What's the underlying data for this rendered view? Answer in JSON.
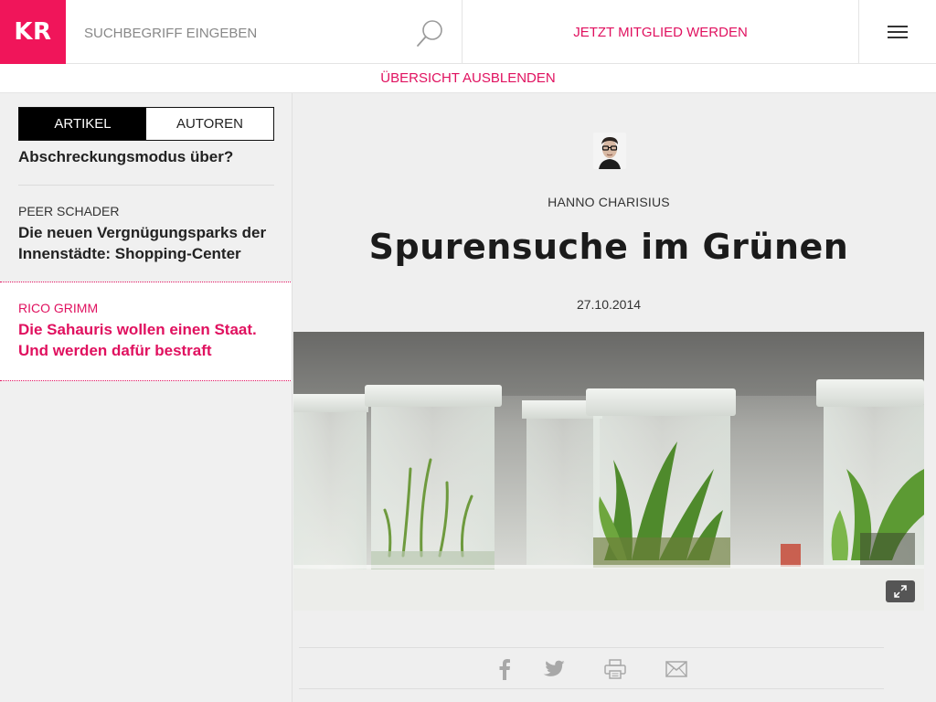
{
  "header": {
    "logo_text": "KR",
    "search_placeholder": "SUCHBEGRIFF EINGEBEN",
    "join_label": "JETZT MITGLIED WERDEN",
    "accent_color": "#e0115f",
    "logo_color": "#f0155a"
  },
  "subbar": {
    "label": "ÜBERSICHT AUSBLENDEN"
  },
  "sidebar": {
    "tabs": [
      {
        "label": "ARTIKEL",
        "active": true
      },
      {
        "label": "AUTOREN",
        "active": false
      }
    ],
    "items": [
      {
        "author": "",
        "title": "Abschreckungsmodus über?"
      },
      {
        "author": "PEER SCHADER",
        "title": "Die neuen Vergnügungsparks der Innenstädte: Shopping-Center"
      },
      {
        "author": "RICO GRIMM",
        "title": "Die Sahauris wollen einen Staat. Und werden dafür bestraft",
        "active": true
      }
    ]
  },
  "article": {
    "author": "HANNO CHARISIUS",
    "title": "Spurensuche im Grünen",
    "date": "27.10.2014",
    "hero_image": "plant-tissue-culture-jars",
    "share_icons": [
      "facebook-icon",
      "twitter-icon",
      "print-icon",
      "mail-icon"
    ]
  }
}
